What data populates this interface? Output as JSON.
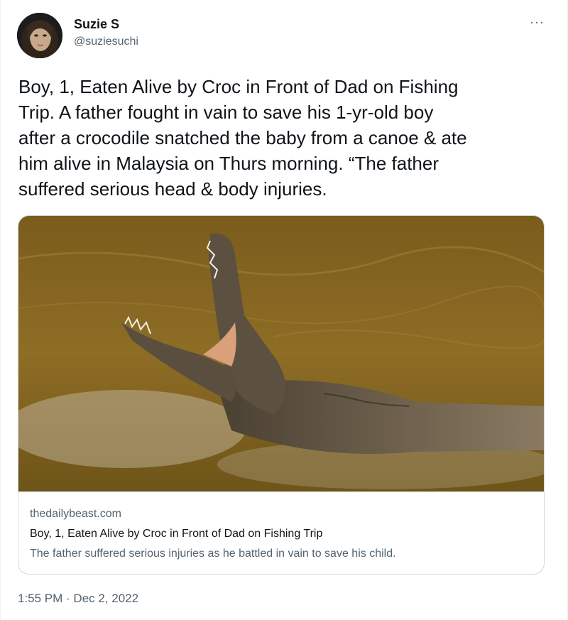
{
  "author": {
    "name": "Suzie S",
    "handle": "@suziesuchi"
  },
  "menu_icon": "more-horizontal-icon",
  "tweet_text": "Boy, 1, Eaten Alive by Croc in Front of Dad on Fishing\nTrip. A father fought in vain to save his 1-yr-old boy\nafter a crocodile snatched the baby from a canoe & ate\nhim alive in Malaysia on Thurs morning. “The father\nsuffered serious head & body injuries.",
  "link_card": {
    "domain": "thedailybeast.com",
    "title": "Boy, 1, Eaten Alive by Croc in Front of Dad on Fishing Trip",
    "description": "The father suffered serious injuries as he battled in vain to save his child."
  },
  "timestamp": "1:55 PM · Dec 2, 2022",
  "colors": {
    "text_primary": "#0f1419",
    "text_secondary": "#536471",
    "border": "#cfd9de",
    "water": "#8a6a22"
  }
}
